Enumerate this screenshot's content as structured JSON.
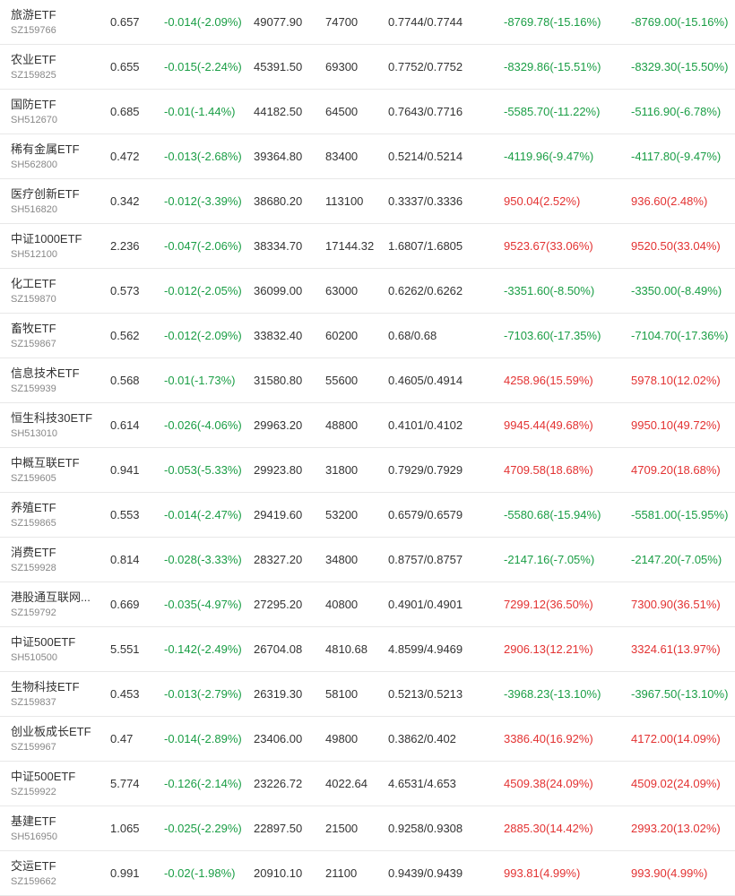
{
  "colors": {
    "gain": "#e33232",
    "loss": "#1a9e45",
    "text": "#333333",
    "code": "#888888",
    "divider": "#e8e8e8"
  },
  "rows": [
    {
      "name": "旅游ETF",
      "code": "SZ159766",
      "price": "0.657",
      "change": "-0.014(-2.09%)",
      "market_value": "49077.90",
      "quantity": "74700",
      "cost": "0.7744/0.7744",
      "pl_a": "-8769.78(-15.16%)",
      "pl_b": "-8769.00(-15.16%)"
    },
    {
      "name": "农业ETF",
      "code": "SZ159825",
      "price": "0.655",
      "change": "-0.015(-2.24%)",
      "market_value": "45391.50",
      "quantity": "69300",
      "cost": "0.7752/0.7752",
      "pl_a": "-8329.86(-15.51%)",
      "pl_b": "-8329.30(-15.50%)"
    },
    {
      "name": "国防ETF",
      "code": "SH512670",
      "price": "0.685",
      "change": "-0.01(-1.44%)",
      "market_value": "44182.50",
      "quantity": "64500",
      "cost": "0.7643/0.7716",
      "pl_a": "-5585.70(-11.22%)",
      "pl_b": "-5116.90(-6.78%)"
    },
    {
      "name": "稀有金属ETF",
      "code": "SH562800",
      "price": "0.472",
      "change": "-0.013(-2.68%)",
      "market_value": "39364.80",
      "quantity": "83400",
      "cost": "0.5214/0.5214",
      "pl_a": "-4119.96(-9.47%)",
      "pl_b": "-4117.80(-9.47%)"
    },
    {
      "name": "医疗创新ETF",
      "code": "SH516820",
      "price": "0.342",
      "change": "-0.012(-3.39%)",
      "market_value": "38680.20",
      "quantity": "113100",
      "cost": "0.3337/0.3336",
      "pl_a": "950.04(2.52%)",
      "pl_b": "936.60(2.48%)"
    },
    {
      "name": "中证1000ETF",
      "code": "SH512100",
      "price": "2.236",
      "change": "-0.047(-2.06%)",
      "market_value": "38334.70",
      "quantity": "17144.32",
      "cost": "1.6807/1.6805",
      "pl_a": "9523.67(33.06%)",
      "pl_b": "9520.50(33.04%)"
    },
    {
      "name": "化工ETF",
      "code": "SZ159870",
      "price": "0.573",
      "change": "-0.012(-2.05%)",
      "market_value": "36099.00",
      "quantity": "63000",
      "cost": "0.6262/0.6262",
      "pl_a": "-3351.60(-8.50%)",
      "pl_b": "-3350.00(-8.49%)"
    },
    {
      "name": "畜牧ETF",
      "code": "SZ159867",
      "price": "0.562",
      "change": "-0.012(-2.09%)",
      "market_value": "33832.40",
      "quantity": "60200",
      "cost": "0.68/0.68",
      "pl_a": "-7103.60(-17.35%)",
      "pl_b": "-7104.70(-17.36%)"
    },
    {
      "name": "信息技术ETF",
      "code": "SZ159939",
      "price": "0.568",
      "change": "-0.01(-1.73%)",
      "market_value": "31580.80",
      "quantity": "55600",
      "cost": "0.4605/0.4914",
      "pl_a": "4258.96(15.59%)",
      "pl_b": "5978.10(12.02%)"
    },
    {
      "name": "恒生科技30ETF",
      "code": "SH513010",
      "price": "0.614",
      "change": "-0.026(-4.06%)",
      "market_value": "29963.20",
      "quantity": "48800",
      "cost": "0.4101/0.4102",
      "pl_a": "9945.44(49.68%)",
      "pl_b": "9950.10(49.72%)"
    },
    {
      "name": "中概互联ETF",
      "code": "SZ159605",
      "price": "0.941",
      "change": "-0.053(-5.33%)",
      "market_value": "29923.80",
      "quantity": "31800",
      "cost": "0.7929/0.7929",
      "pl_a": "4709.58(18.68%)",
      "pl_b": "4709.20(18.68%)"
    },
    {
      "name": "养殖ETF",
      "code": "SZ159865",
      "price": "0.553",
      "change": "-0.014(-2.47%)",
      "market_value": "29419.60",
      "quantity": "53200",
      "cost": "0.6579/0.6579",
      "pl_a": "-5580.68(-15.94%)",
      "pl_b": "-5581.00(-15.95%)"
    },
    {
      "name": "消费ETF",
      "code": "SZ159928",
      "price": "0.814",
      "change": "-0.028(-3.33%)",
      "market_value": "28327.20",
      "quantity": "34800",
      "cost": "0.8757/0.8757",
      "pl_a": "-2147.16(-7.05%)",
      "pl_b": "-2147.20(-7.05%)"
    },
    {
      "name": "港股通互联网...",
      "code": "SZ159792",
      "price": "0.669",
      "change": "-0.035(-4.97%)",
      "market_value": "27295.20",
      "quantity": "40800",
      "cost": "0.4901/0.4901",
      "pl_a": "7299.12(36.50%)",
      "pl_b": "7300.90(36.51%)"
    },
    {
      "name": "中证500ETF",
      "code": "SH510500",
      "price": "5.551",
      "change": "-0.142(-2.49%)",
      "market_value": "26704.08",
      "quantity": "4810.68",
      "cost": "4.8599/4.9469",
      "pl_a": "2906.13(12.21%)",
      "pl_b": "3324.61(13.97%)"
    },
    {
      "name": "生物科技ETF",
      "code": "SZ159837",
      "price": "0.453",
      "change": "-0.013(-2.79%)",
      "market_value": "26319.30",
      "quantity": "58100",
      "cost": "0.5213/0.5213",
      "pl_a": "-3968.23(-13.10%)",
      "pl_b": "-3967.50(-13.10%)"
    },
    {
      "name": "创业板成长ETF",
      "code": "SZ159967",
      "price": "0.47",
      "change": "-0.014(-2.89%)",
      "market_value": "23406.00",
      "quantity": "49800",
      "cost": "0.3862/0.402",
      "pl_a": "3386.40(16.92%)",
      "pl_b": "4172.00(14.09%)"
    },
    {
      "name": "中证500ETF",
      "code": "SZ159922",
      "price": "5.774",
      "change": "-0.126(-2.14%)",
      "market_value": "23226.72",
      "quantity": "4022.64",
      "cost": "4.6531/4.653",
      "pl_a": "4509.38(24.09%)",
      "pl_b": "4509.02(24.09%)"
    },
    {
      "name": "基建ETF",
      "code": "SH516950",
      "price": "1.065",
      "change": "-0.025(-2.29%)",
      "market_value": "22897.50",
      "quantity": "21500",
      "cost": "0.9258/0.9308",
      "pl_a": "2885.30(14.42%)",
      "pl_b": "2993.20(13.02%)"
    },
    {
      "name": "交运ETF",
      "code": "SZ159662",
      "price": "0.991",
      "change": "-0.02(-1.98%)",
      "market_value": "20910.10",
      "quantity": "21100",
      "cost": "0.9439/0.9439",
      "pl_a": "993.81(4.99%)",
      "pl_b": "993.90(4.99%)"
    }
  ]
}
